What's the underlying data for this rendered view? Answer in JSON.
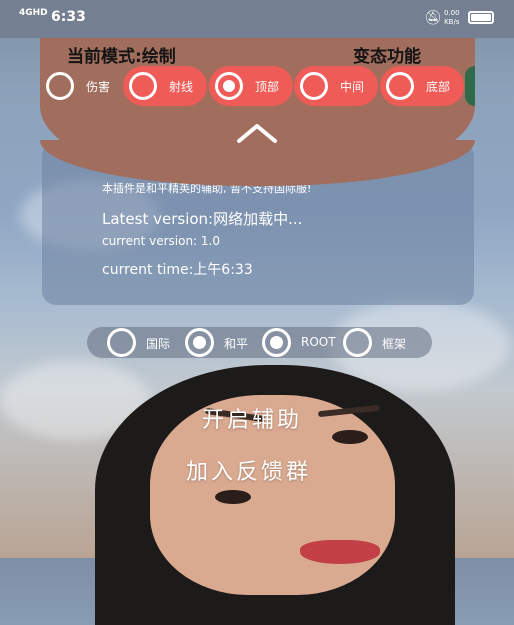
{
  "status_bar": {
    "network": "4GHD",
    "time": "6:33",
    "speed_value": "0.00",
    "speed_unit": "KB/s"
  },
  "panel": {
    "mode_label": "当前模式:绘制",
    "morph_label": "变态功能",
    "modes": [
      {
        "label": "伤害",
        "selected": false
      },
      {
        "label": "射线",
        "selected": false
      },
      {
        "label": "顶部",
        "selected": true
      },
      {
        "label": "中间",
        "selected": false
      },
      {
        "label": "底部",
        "selected": false
      }
    ],
    "colors": {
      "panel": "#a16d5d",
      "chip": "#ef5b57"
    }
  },
  "info": {
    "notice": "本插件是和平精英的辅助, 暂不支持国际服!",
    "latest_version": "Latest version:网络加载中...",
    "current_version": "current version: 1.0",
    "current_time": "current time:上午6:33"
  },
  "servers": [
    {
      "label": "国际",
      "selected": false
    },
    {
      "label": "和平",
      "selected": true
    },
    {
      "label": "ROOT",
      "selected": true
    },
    {
      "label": "框架",
      "selected": false
    }
  ],
  "actions": {
    "enable_assist": "开启辅助",
    "join_group": "加入反馈群"
  }
}
